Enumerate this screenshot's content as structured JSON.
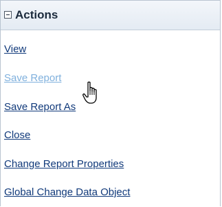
{
  "panel": {
    "title": "Actions",
    "collapse_icon": "minus-box-icon",
    "hover_color": "#7fb0dd",
    "link_color": "#10397a"
  },
  "actions": [
    {
      "label": "View"
    },
    {
      "label": "Save Report",
      "hovered": true
    },
    {
      "label": "Save Report As"
    },
    {
      "label": "Close"
    },
    {
      "label": "Change Report Properties"
    },
    {
      "label": "Global Change Data Object"
    }
  ],
  "cursor": {
    "icon": "hand-pointer-icon"
  }
}
